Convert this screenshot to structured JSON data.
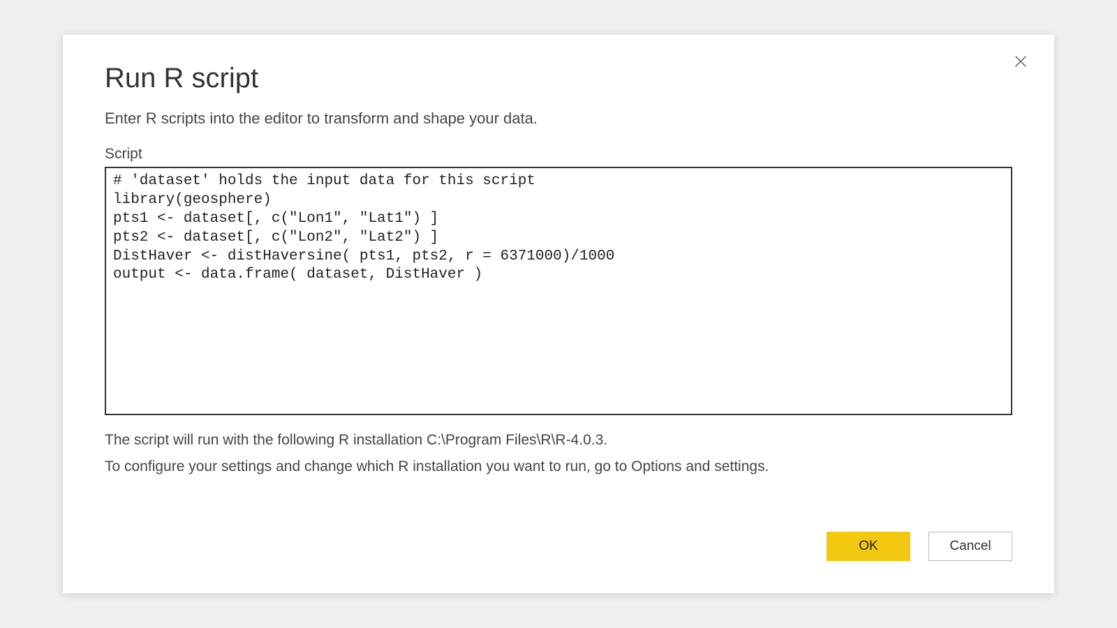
{
  "dialog": {
    "title": "Run R script",
    "subtitle": "Enter R scripts into the editor to transform and shape your data.",
    "script_label": "Script",
    "script_content": "# 'dataset' holds the input data for this script\nlibrary(geosphere)\npts1 <- dataset[, c(\"Lon1\", \"Lat1\") ]\npts2 <- dataset[, c(\"Lon2\", \"Lat2\") ]\nDistHaver <- distHaversine( pts1, pts2, r = 6371000)/1000\noutput <- data.frame( dataset, DistHaver )",
    "info_line1": "The script will run with the following R installation C:\\Program Files\\R\\R-4.0.3.",
    "info_line2": "To configure your settings and change which R installation you want to run, go to Options and settings.",
    "ok_label": "OK",
    "cancel_label": "Cancel"
  }
}
